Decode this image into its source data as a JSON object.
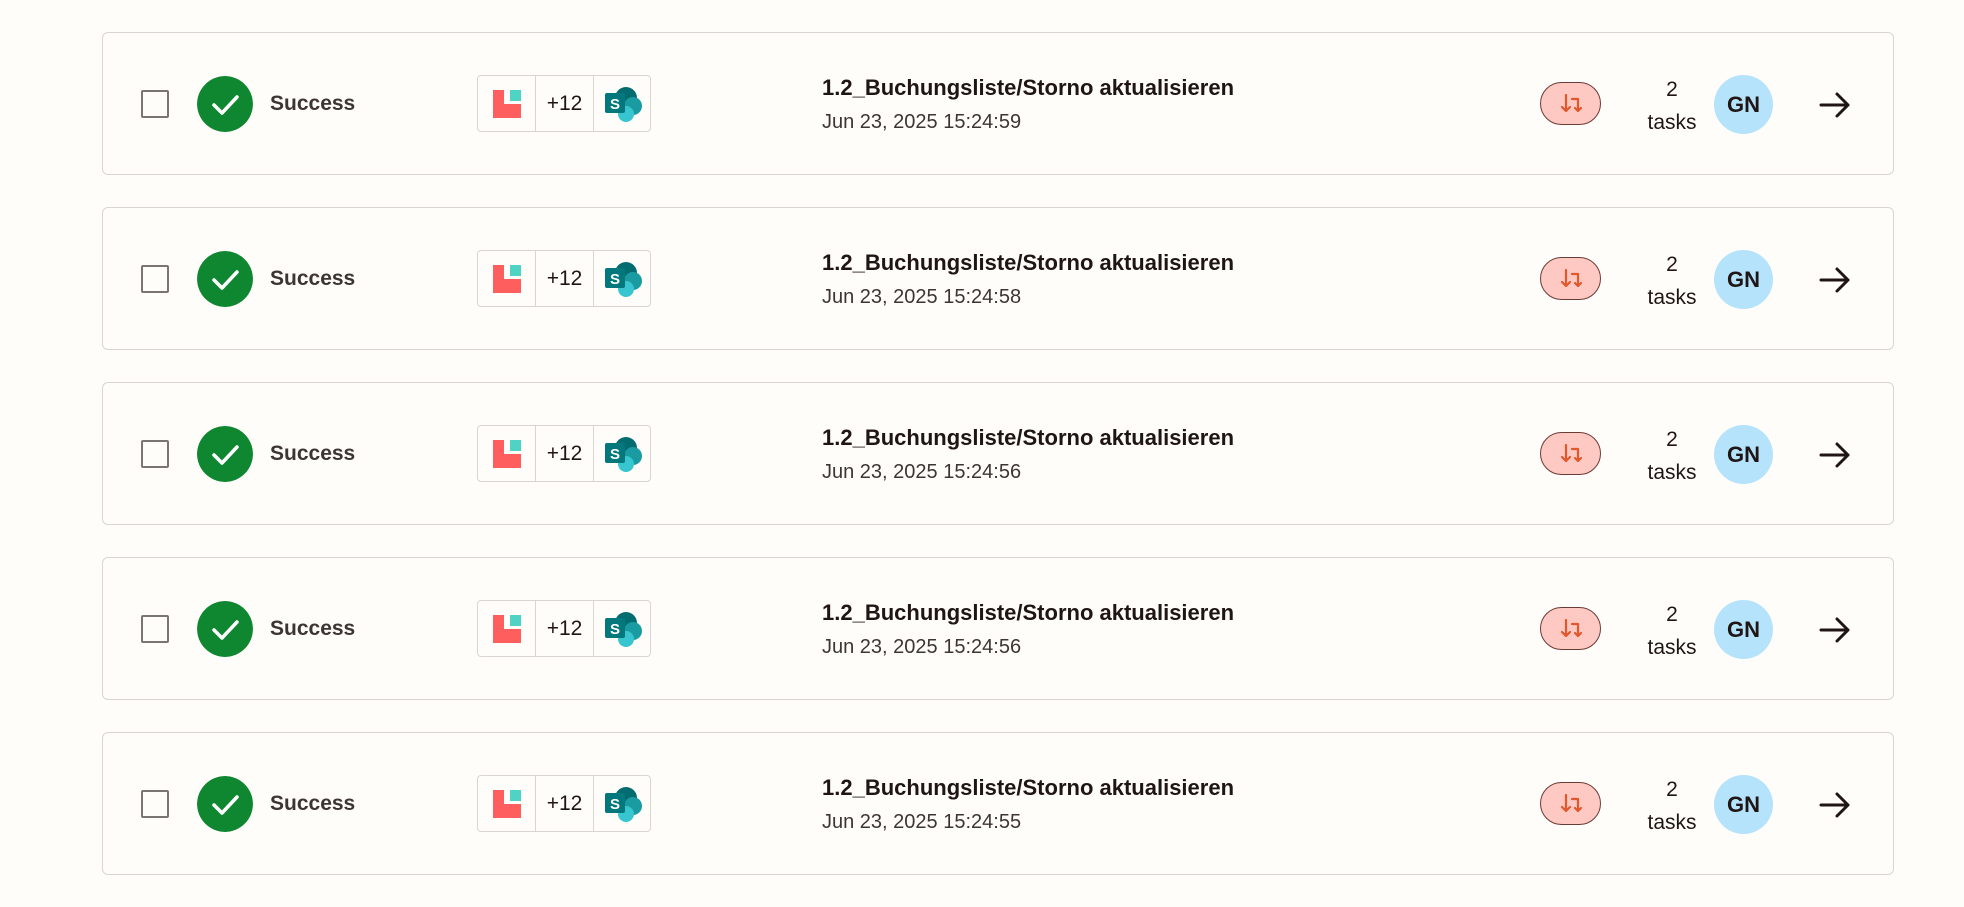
{
  "colors": {
    "success": "#0f8731",
    "badge_bg": "#ffc9c3",
    "badge_arrow": "#e0582b",
    "avatar_bg": "#b5e3fb",
    "app_red": "#ff5e5e",
    "app_teal": "#4fd3c4",
    "sharepoint": "#03787c"
  },
  "icons": {
    "status": "check-circle-icon",
    "first_app": "red-app-logo-icon",
    "last_app": "sharepoint-icon",
    "badge": "transfer-arrows-icon",
    "open": "arrow-right-icon"
  },
  "runs": [
    {
      "status": "Success",
      "apps_more": "+12",
      "app_letter": "S",
      "title": "1.2_Buchungsliste/Storno aktualisieren",
      "timestamp": "Jun 23, 2025 15:24:59",
      "task_count": "2",
      "task_unit": "tasks",
      "owner_initials": "GN"
    },
    {
      "status": "Success",
      "apps_more": "+12",
      "app_letter": "S",
      "title": "1.2_Buchungsliste/Storno aktualisieren",
      "timestamp": "Jun 23, 2025 15:24:58",
      "task_count": "2",
      "task_unit": "tasks",
      "owner_initials": "GN"
    },
    {
      "status": "Success",
      "apps_more": "+12",
      "app_letter": "S",
      "title": "1.2_Buchungsliste/Storno aktualisieren",
      "timestamp": "Jun 23, 2025 15:24:56",
      "task_count": "2",
      "task_unit": "tasks",
      "owner_initials": "GN"
    },
    {
      "status": "Success",
      "apps_more": "+12",
      "app_letter": "S",
      "title": "1.2_Buchungsliste/Storno aktualisieren",
      "timestamp": "Jun 23, 2025 15:24:56",
      "task_count": "2",
      "task_unit": "tasks",
      "owner_initials": "GN"
    },
    {
      "status": "Success",
      "apps_more": "+12",
      "app_letter": "S",
      "title": "1.2_Buchungsliste/Storno aktualisieren",
      "timestamp": "Jun 23, 2025 15:24:55",
      "task_count": "2",
      "task_unit": "tasks",
      "owner_initials": "GN"
    }
  ]
}
